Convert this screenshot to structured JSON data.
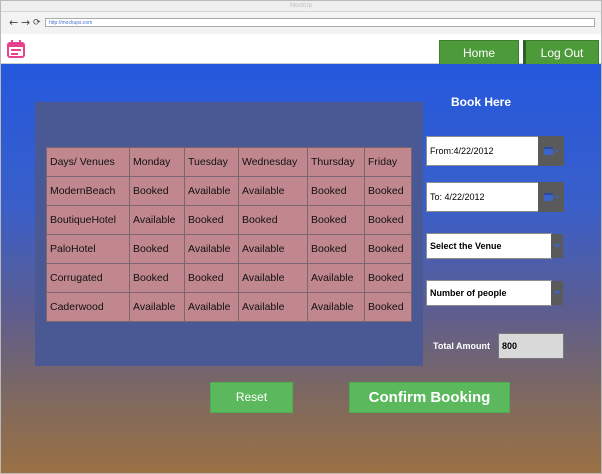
{
  "browser": {
    "title": "MockUp",
    "url": "http://mockups.com",
    "back_glyph": "←",
    "forward_glyph": "→",
    "reload_glyph": "⟳"
  },
  "header": {
    "home_label": "Home",
    "logout_label": "Log Out",
    "logo_icon": "calendar-icon",
    "logo_color": "#e8428a"
  },
  "table": {
    "rows": [
      [
        "Days/ Venues",
        "Monday",
        "Tuesday",
        "Wednesday",
        "Thursday",
        "Friday"
      ],
      [
        "ModernBeach",
        "Booked",
        "Available",
        "Available",
        "Booked",
        "Booked"
      ],
      [
        "BoutiqueHotel",
        "Available",
        "Booked",
        "Booked",
        "Booked",
        "Booked"
      ],
      [
        "PaloHotel",
        "Booked",
        "Available",
        "Available",
        "Booked",
        "Booked"
      ],
      [
        "Corrugated",
        "Booked",
        "Booked",
        "Available",
        "Available",
        "Booked"
      ],
      [
        "Caderwood",
        "Available",
        "Available",
        "Available",
        "Available",
        "Booked"
      ]
    ]
  },
  "booking": {
    "title": "Book Here",
    "from_value": "From:4/22/2012",
    "to_value": "To: 4/22/2012",
    "venue_select": "Select the Venue",
    "people_select": "Number of people",
    "total_label": "Total Amount",
    "total_value": "800",
    "reset_label": "Reset",
    "confirm_label": "Confirm Booking"
  },
  "colors": {
    "button_green": "#5cb85c",
    "header_green": "#4c9a3a",
    "table_bg": "#c1878e"
  }
}
